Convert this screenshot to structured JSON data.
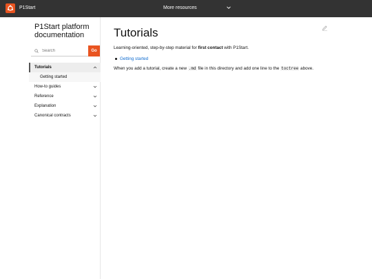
{
  "topbar": {
    "brand_name": "P1Start",
    "more_resources": "More resources"
  },
  "sidebar": {
    "project_title": "P1Start platform documentation",
    "search_placeholder": "Search",
    "search_go": "Go",
    "items": [
      {
        "label": "Tutorials",
        "active": true,
        "expanded": true
      },
      {
        "label": "Getting started",
        "sub": true
      },
      {
        "label": "How-to guides"
      },
      {
        "label": "Reference"
      },
      {
        "label": "Explanation"
      },
      {
        "label": "Canonical contracts"
      }
    ]
  },
  "main": {
    "title": "Tutorials",
    "intro_before": "Learning-oriented, step-by-step material for ",
    "intro_bold": "first contact",
    "intro_after": " with P1Start.",
    "toc_link": "Getting started",
    "body_1": "When you add a tutorial, create a new ",
    "body_code_1": ".md",
    "body_2": " file in this directory and add one line to the ",
    "body_code_2": "toctree",
    "body_3": " above."
  },
  "colors": {
    "topbar": "#333333",
    "accent": "#e95420",
    "link": "#0e6bcf"
  }
}
